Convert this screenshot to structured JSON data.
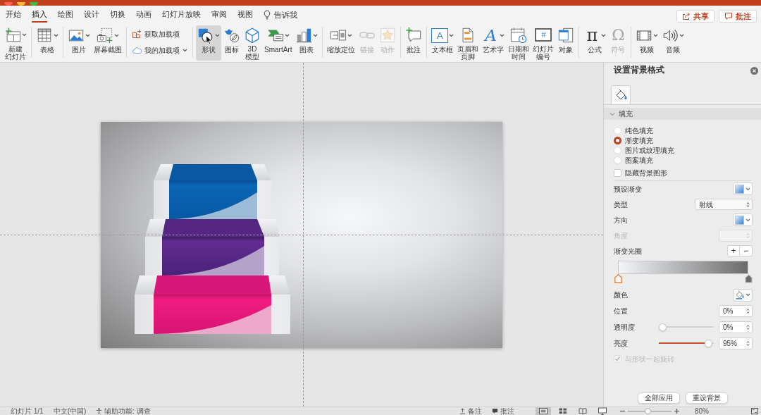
{
  "window": {
    "controls": [
      {
        "color": "#fe5f57"
      },
      {
        "color": "#febc2e"
      },
      {
        "color": "#28c840"
      }
    ]
  },
  "tabs": [
    {
      "label": "开始",
      "selected": false
    },
    {
      "label": "插入",
      "selected": true
    },
    {
      "label": "绘图",
      "selected": false
    },
    {
      "label": "设计",
      "selected": false
    },
    {
      "label": "切换",
      "selected": false
    },
    {
      "label": "动画",
      "selected": false
    },
    {
      "label": "幻灯片放映",
      "selected": false
    },
    {
      "label": "审阅",
      "selected": false
    },
    {
      "label": "视图",
      "selected": false
    }
  ],
  "tell_me": {
    "label": "告诉我"
  },
  "header_buttons": [
    {
      "kind": "share",
      "label": "共享"
    },
    {
      "kind": "comments",
      "label": "批注"
    }
  ],
  "ribbon": {
    "groups": [
      {
        "items": [
          {
            "kind": "newslide",
            "lines": [
              "新建",
              "幻灯片"
            ],
            "menu": true,
            "disabled": false,
            "hovered": false
          }
        ]
      },
      {
        "items": [
          {
            "kind": "table",
            "label": "表格",
            "menu": true,
            "disabled": false,
            "hovered": false
          }
        ]
      },
      {
        "items": [
          {
            "kind": "picture",
            "label": "图片",
            "menu": true,
            "disabled": false,
            "hovered": false
          },
          {
            "kind": "screenshot",
            "label": "屏幕截图",
            "menu": true,
            "disabled": false,
            "hovered": false
          }
        ]
      },
      {
        "items": [
          {
            "kind": "getaddins",
            "label": "获取加载项",
            "menu": false,
            "disabled": false,
            "hovered": false
          },
          {
            "kind": "myaddins",
            "label": "我的加载项",
            "menu": true,
            "disabled": false,
            "hovered": false
          }
        ]
      },
      {
        "items": [
          {
            "kind": "shapes",
            "label": "形状",
            "menu": true,
            "disabled": false,
            "hovered": true
          },
          {
            "kind": "icons",
            "label": "图标",
            "menu": false,
            "disabled": false,
            "hovered": false
          },
          {
            "kind": "model3d",
            "lines": [
              "3D",
              "模型"
            ],
            "menu": false,
            "disabled": false,
            "hovered": false
          },
          {
            "kind": "smartart",
            "label": "SmartArt",
            "menu": true,
            "disabled": false,
            "hovered": false
          },
          {
            "kind": "chart",
            "label": "图表",
            "menu": true,
            "disabled": false,
            "hovered": false
          }
        ]
      },
      {
        "items": [
          {
            "kind": "zoom",
            "label": "缩放定位",
            "menu": true,
            "disabled": false,
            "hovered": false
          },
          {
            "kind": "link",
            "label": "链接",
            "menu": false,
            "disabled": true,
            "hovered": false
          },
          {
            "kind": "action",
            "label": "动作",
            "menu": false,
            "disabled": true,
            "hovered": false
          }
        ]
      },
      {
        "items": [
          {
            "kind": "comment",
            "label": "批注",
            "menu": false,
            "disabled": false,
            "hovered": false
          }
        ]
      },
      {
        "items": [
          {
            "kind": "textbox",
            "label": "文本框",
            "glyph": "A",
            "menu": true,
            "disabled": false,
            "hovered": false
          },
          {
            "kind": "headerfooter",
            "lines": [
              "页眉和",
              "页脚"
            ],
            "menu": false,
            "disabled": false,
            "hovered": false
          },
          {
            "kind": "wordart",
            "label": "艺术字",
            "glyph": "A",
            "menu": true,
            "disabled": false,
            "hovered": false
          },
          {
            "kind": "datetime",
            "lines": [
              "日期和",
              "时间"
            ],
            "menu": false,
            "disabled": false,
            "hovered": false
          },
          {
            "kind": "slidenumber",
            "lines": [
              "幻灯片",
              "编号"
            ],
            "glyph": "#",
            "menu": false,
            "disabled": false,
            "hovered": false
          },
          {
            "kind": "object",
            "label": "对象",
            "menu": false,
            "disabled": false,
            "hovered": false
          }
        ]
      },
      {
        "items": [
          {
            "kind": "equation",
            "label": "公式",
            "glyph": "π",
            "menu": true,
            "disabled": false,
            "hovered": false
          },
          {
            "kind": "symbol",
            "label": "符号",
            "glyph": "Ω",
            "menu": false,
            "disabled": true,
            "hovered": false
          }
        ]
      },
      {
        "items": [
          {
            "kind": "video",
            "label": "视频",
            "menu": true,
            "disabled": false,
            "hovered": false
          },
          {
            "kind": "audio",
            "label": "音频",
            "menu": true,
            "disabled": false,
            "hovered": false
          }
        ]
      }
    ]
  },
  "format_pane": {
    "title": "设置背景格式",
    "tabs": [
      {
        "kind": "fill",
        "selected": true
      }
    ],
    "section": {
      "label": "填充",
      "expanded": true
    },
    "fill_types": [
      {
        "label": "纯色填充",
        "selected": false
      },
      {
        "label": "渐变填充",
        "selected": true
      },
      {
        "label": "图片或纹理填充",
        "selected": false
      },
      {
        "label": "图案填充",
        "selected": false
      }
    ],
    "hide_background_graphics": {
      "label": "隐藏背景图形",
      "checked": false
    },
    "settings": [
      {
        "kind": "swatch",
        "label": "预设渐变",
        "disabled": false
      },
      {
        "kind": "select",
        "label": "类型",
        "value": "射线",
        "disabled": false
      },
      {
        "kind": "swatch",
        "label": "方向",
        "disabled": false
      },
      {
        "kind": "spinner",
        "label": "角度",
        "disabled": true
      }
    ],
    "gradient": {
      "label": "渐变光圈",
      "buttons": [
        "+",
        "−"
      ],
      "stops": [
        {
          "selected": true,
          "color": "#f3f5f9"
        },
        {
          "selected": false,
          "color": "#6b6b6b"
        }
      ]
    },
    "stop_settings": [
      {
        "kind": "color",
        "label": "颜色",
        "disabled": false
      },
      {
        "kind": "spinner",
        "label": "位置",
        "value": "0%",
        "disabled": false
      },
      {
        "kind": "slider",
        "label": "透明度",
        "level": 0,
        "value": "0%",
        "disabled": false
      },
      {
        "kind": "slider",
        "label": "亮度",
        "level": 0.97,
        "value": "95%",
        "disabled": false
      }
    ],
    "rotate_with_shape": {
      "label": "与形状一起旋转",
      "checked": true,
      "disabled": true
    },
    "buttons": [
      "全部应用",
      "重设背景"
    ]
  },
  "status_bar": {
    "items": [
      {
        "kind": "text",
        "label": "幻灯片 1/1"
      },
      {
        "kind": "text",
        "label": "中文(中国)"
      },
      {
        "kind": "accessibility",
        "label": "辅助功能: 调查"
      }
    ],
    "toggles": [
      {
        "kind": "notes",
        "label": "备注"
      },
      {
        "kind": "comments",
        "label": "批注"
      }
    ],
    "views": [
      {
        "kind": "normal",
        "selected": true
      },
      {
        "kind": "sorter",
        "selected": false
      },
      {
        "kind": "reading",
        "selected": false
      },
      {
        "kind": "slideshow",
        "selected": false
      }
    ],
    "zoom": {
      "level": 0.45,
      "label": "80%"
    }
  }
}
